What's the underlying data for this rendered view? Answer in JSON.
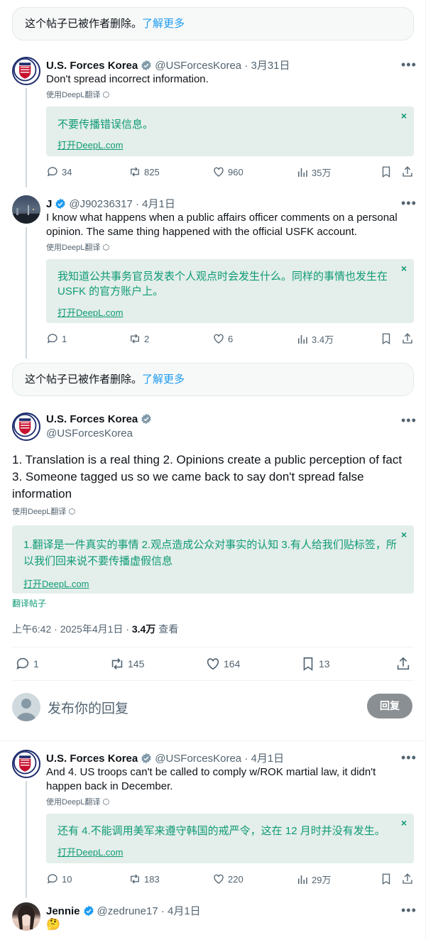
{
  "deleted_notice": {
    "text": "这个帖子已被作者删除。",
    "link": "了解更多"
  },
  "translate_label": "使用DeepL翻译",
  "open_deepl": "打开DeepL.com",
  "close_x": "×",
  "more": "•••",
  "post1": {
    "name": "U.S. Forces Korea",
    "handle": "@USForcesKorea",
    "date": "· 3月31日",
    "text": "Don't spread incorrect information.",
    "translation": "不要传播错误信息。",
    "replies": "34",
    "reposts": "825",
    "likes": "960",
    "views": "35万"
  },
  "post2": {
    "name": "J",
    "handle": "@J90236317",
    "date": "· 4月1日",
    "text_line1": "I know what happens when a public affairs officer comments on a personal",
    "text_line2": "opinion. The same thing happened with the official USFK account.",
    "translation_line1": "我知道公共事务官员发表个人观点时会发生什么。同样的事情也发生在",
    "translation_line2": "USFK 的官方账户上。",
    "replies": "1",
    "reposts": "2",
    "likes": "6",
    "views": "3.4万"
  },
  "main_post": {
    "name": "U.S. Forces Korea",
    "handle": "@USForcesKorea",
    "line1": "1. Translation is a real thing 2. Opinions create a public perception of fact",
    "line2": "3. Someone tagged us so we came back to say don't spread false",
    "line3": "information",
    "translation_line1": "1.翻译是一件真实的事情 2.观点造成公众对事实的认知 3.有人给我们贴标签，所",
    "translation_line2": "以我们回来说不要传播虚假信息",
    "translate_post": "翻译帖子",
    "time": "上午6:42 · 2025年4月1日 · ",
    "views_count": "3.4万",
    "views_label": " 查看",
    "replies": "1",
    "reposts": "145",
    "likes": "164",
    "bookmarks": "13"
  },
  "reply_box": {
    "placeholder": "发布你的回复",
    "button": "回复"
  },
  "post3": {
    "name": "U.S. Forces Korea",
    "handle": "@USForcesKorea",
    "date": "· 4月1日",
    "text_line1": "And 4. US troops can't be called to comply w/ROK martial law, it didn't",
    "text_line2": "happen back in December.",
    "translation": "还有 4.不能调用美军来遵守韩国的戒严令，这在 12 月时并没有发生。",
    "replies": "10",
    "reposts": "183",
    "likes": "220",
    "views": "29万"
  },
  "post4": {
    "name": "Jennie",
    "handle": "@zedrune17",
    "date": "· 4月1日",
    "text": "🤔"
  },
  "colors": {
    "accent": "#1d9bf0",
    "translation_bg": "#e4eeea",
    "translation_text": "#0f9b76",
    "muted": "#536471"
  }
}
